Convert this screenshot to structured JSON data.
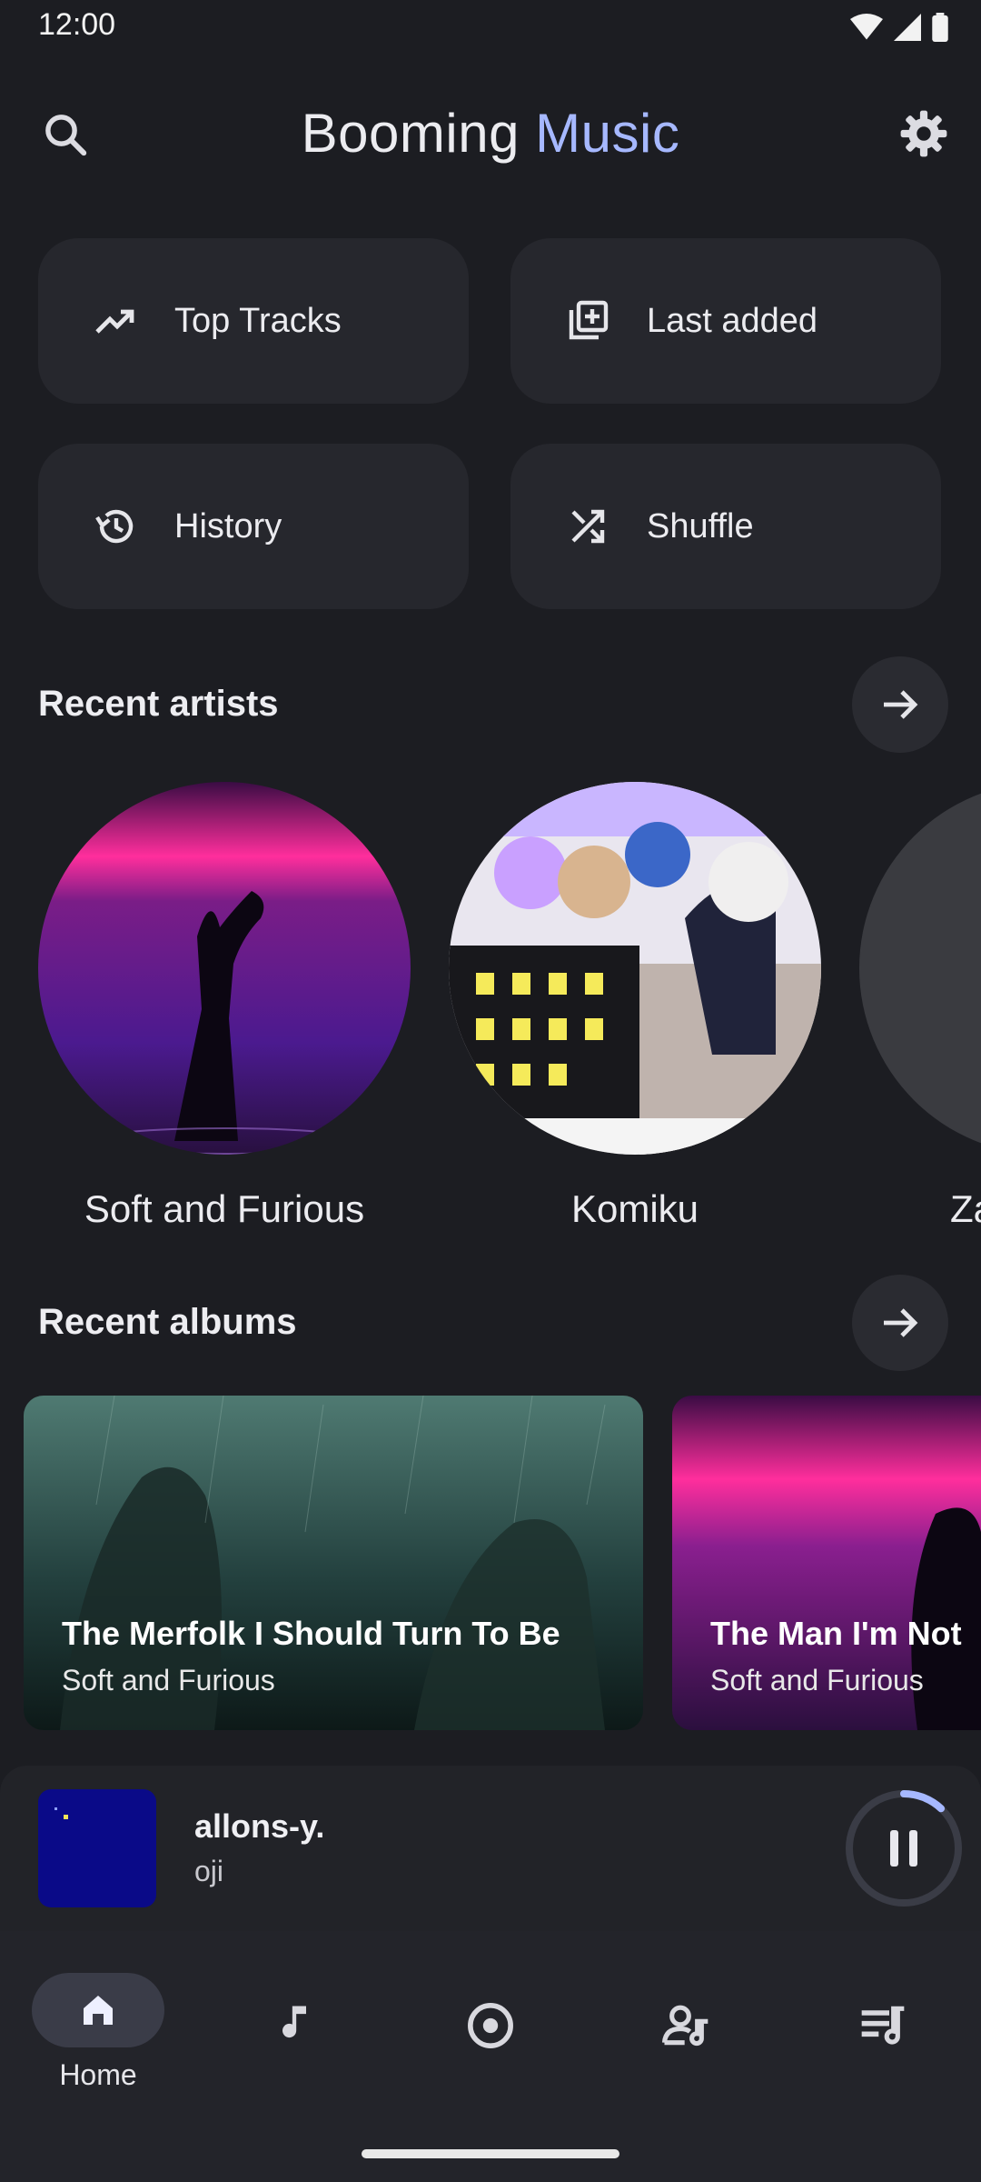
{
  "status_bar": {
    "time": "12:00"
  },
  "header": {
    "title_primary": "Booming",
    "title_accent": "Music",
    "search_icon": "search-icon",
    "settings_icon": "gear-icon"
  },
  "quick_actions": [
    {
      "label": "Top Tracks",
      "icon": "trending-up-icon"
    },
    {
      "label": "Last added",
      "icon": "library-add-icon"
    },
    {
      "label": "History",
      "icon": "history-icon"
    },
    {
      "label": "Shuffle",
      "icon": "shuffle-icon"
    }
  ],
  "recent_artists": {
    "title": "Recent artists",
    "items": [
      {
        "name": "Soft and Furious"
      },
      {
        "name": "Komiku"
      },
      {
        "name": "Za"
      }
    ]
  },
  "recent_albums": {
    "title": "Recent albums",
    "items": [
      {
        "title": "The Merfolk I Should Turn To Be",
        "artist": "Soft and Furious"
      },
      {
        "title": "The Man I'm Not",
        "artist": "Soft and Furious"
      }
    ]
  },
  "now_playing": {
    "title": "allons-y.",
    "artist": "oji",
    "state": "playing",
    "progress": 0.12
  },
  "bottom_nav": {
    "items": [
      {
        "label": "Home",
        "icon": "home-icon",
        "active": true
      },
      {
        "label": "",
        "icon": "music-note-icon",
        "active": false
      },
      {
        "label": "",
        "icon": "album-icon",
        "active": false
      },
      {
        "label": "",
        "icon": "artist-icon",
        "active": false
      },
      {
        "label": "",
        "icon": "playlist-icon",
        "active": false
      }
    ]
  },
  "colors": {
    "background": "#1c1d22",
    "accent": "#a6b8ff",
    "tile": "#26272d"
  }
}
